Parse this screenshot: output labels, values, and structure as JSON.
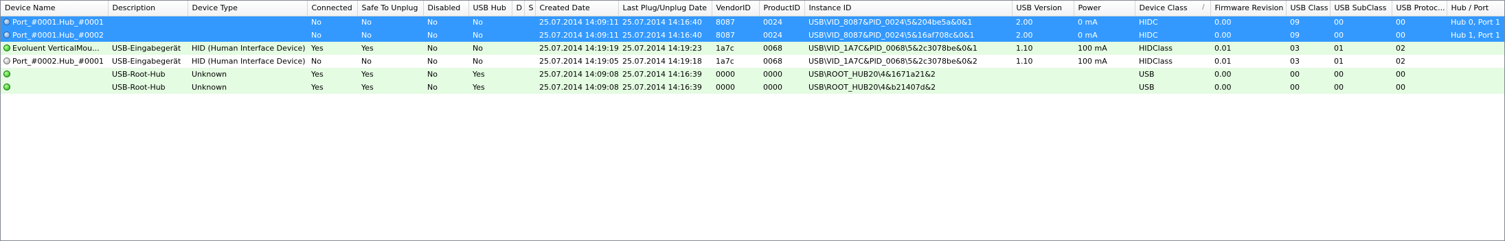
{
  "columns": [
    {
      "label": "Device Name"
    },
    {
      "label": "Description"
    },
    {
      "label": "Device Type"
    },
    {
      "label": "Connected"
    },
    {
      "label": "Safe To Unplug"
    },
    {
      "label": "Disabled"
    },
    {
      "label": "USB Hub"
    },
    {
      "label": "D"
    },
    {
      "label": "S"
    },
    {
      "label": "Created Date"
    },
    {
      "label": "Last Plug/Unplug Date"
    },
    {
      "label": "VendorID"
    },
    {
      "label": "ProductID"
    },
    {
      "label": "Instance ID"
    },
    {
      "label": "USB Version"
    },
    {
      "label": "Power"
    },
    {
      "label": "Device Class"
    },
    {
      "label": "Firmware Revision"
    },
    {
      "label": "USB Class"
    },
    {
      "label": "USB SubClass"
    },
    {
      "label": "USB Protoc..."
    },
    {
      "label": "Hub / Port"
    }
  ],
  "sort_column_glyph": "/",
  "rows": [
    {
      "status_icon": "blue-status-icon",
      "selected": true,
      "cells": [
        "Port_#0001.Hub_#0001",
        "",
        "",
        "No",
        "No",
        "No",
        "No",
        "",
        "",
        "25.07.2014 14:09:11",
        "25.07.2014 14:16:40",
        "8087",
        "0024",
        "USB\\VID_8087&PID_0024\\5&204be5a&0&1",
        "2.00",
        "0 mA",
        "HIDC",
        "0.00",
        "09",
        "00",
        "00",
        "Hub 0, Port 1"
      ]
    },
    {
      "status_icon": "blue-status-icon",
      "selected": true,
      "cells": [
        "Port_#0001.Hub_#0002",
        "",
        "",
        "No",
        "No",
        "No",
        "No",
        "",
        "",
        "25.07.2014 14:09:11",
        "25.07.2014 14:16:40",
        "8087",
        "0024",
        "USB\\VID_8087&PID_0024\\5&16af708c&0&1",
        "2.00",
        "0 mA",
        "HIDC",
        "0.00",
        "09",
        "00",
        "00",
        "Hub 1, Port 1"
      ]
    },
    {
      "status_icon": "green-status-icon",
      "selected": false,
      "tint": "green",
      "cells": [
        "Evoluent VerticalMou...",
        "USB-Eingabegerät",
        "HID (Human Interface Device)",
        "Yes",
        "Yes",
        "No",
        "No",
        "",
        "",
        "25.07.2014 14:19:19",
        "25.07.2014 14:19:23",
        "1a7c",
        "0068",
        "USB\\VID_1A7C&PID_0068\\5&2c3078be&0&1",
        "1.10",
        "100 mA",
        "HIDClass",
        "0.01",
        "03",
        "01",
        "02",
        ""
      ]
    },
    {
      "status_icon": "gray-status-icon",
      "selected": false,
      "tint": "white",
      "cells": [
        "Port_#0002.Hub_#0001",
        "USB-Eingabegerät",
        "HID (Human Interface Device)",
        "No",
        "No",
        "No",
        "No",
        "",
        "",
        "25.07.2014 14:19:05",
        "25.07.2014 14:19:18",
        "1a7c",
        "0068",
        "USB\\VID_1A7C&PID_0068\\5&2c3078be&0&2",
        "1.10",
        "100 mA",
        "HIDClass",
        "0.01",
        "03",
        "01",
        "02",
        ""
      ]
    },
    {
      "status_icon": "green-status-icon",
      "selected": false,
      "tint": "green",
      "cells": [
        "",
        "USB-Root-Hub",
        "Unknown",
        "Yes",
        "Yes",
        "No",
        "Yes",
        "",
        "",
        "25.07.2014 14:09:08",
        "25.07.2014 14:16:39",
        "0000",
        "0000",
        "USB\\ROOT_HUB20\\4&1671a21&2",
        "",
        "",
        "USB",
        "0.00",
        "00",
        "00",
        "00",
        ""
      ]
    },
    {
      "status_icon": "green-status-icon",
      "selected": false,
      "tint": "green",
      "cells": [
        "",
        "USB-Root-Hub",
        "Unknown",
        "Yes",
        "Yes",
        "No",
        "Yes",
        "",
        "",
        "25.07.2014 14:09:08",
        "25.07.2014 14:16:39",
        "0000",
        "0000",
        "USB\\ROOT_HUB20\\4&b21407d&2",
        "",
        "",
        "USB",
        "0.00",
        "00",
        "00",
        "00",
        ""
      ]
    }
  ]
}
